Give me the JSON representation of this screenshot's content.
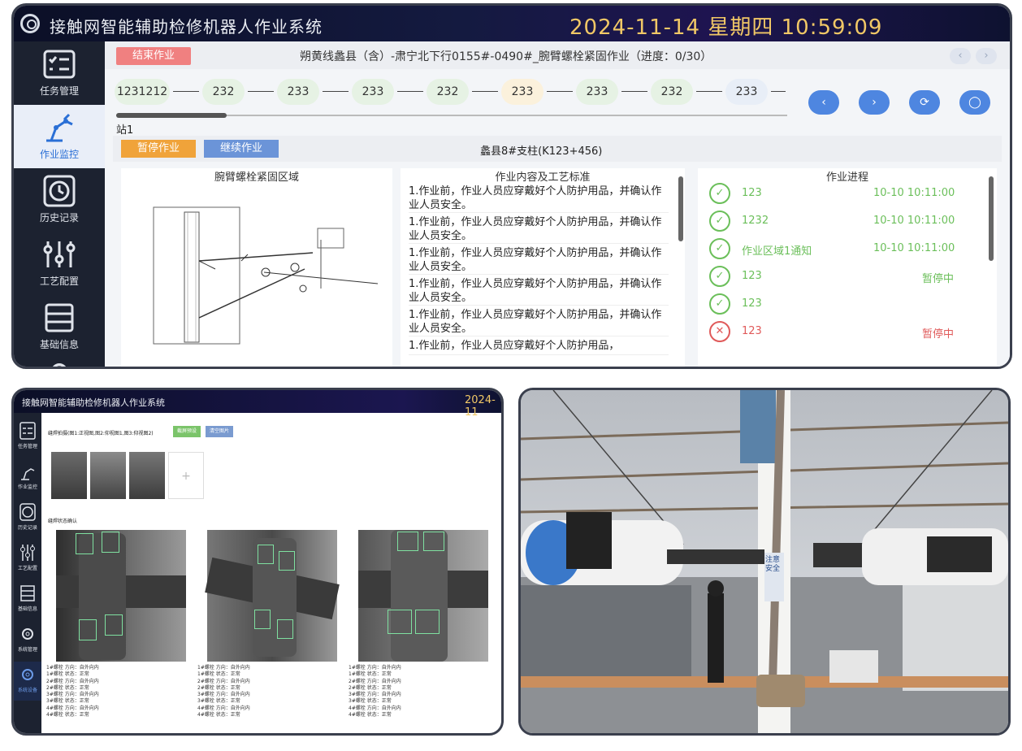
{
  "app": {
    "title": "接触网智能辅助检修机器人作业系统",
    "datetime": "2024-11-14 星期四 10:59:09"
  },
  "sidebar": {
    "items": [
      {
        "label": "任务管理"
      },
      {
        "label": "作业监控"
      },
      {
        "label": "历史记录"
      },
      {
        "label": "工艺配置"
      },
      {
        "label": "基础信息"
      }
    ]
  },
  "header": {
    "end_btn": "结束作业",
    "job_title": "朔黄线蠡县（含）-肃宁北下行0155#-0490#_腕臂螺栓紧固作业（进度：0/30）",
    "prev": "‹",
    "next": "›"
  },
  "stations": {
    "nodes": [
      "1231212",
      "232",
      "233",
      "233",
      "232",
      "233",
      "233",
      "232",
      "233"
    ],
    "current_label": "站1"
  },
  "controls": {
    "prev": "‹",
    "next": "›",
    "refresh": "⟳",
    "chat": "◯"
  },
  "work": {
    "pause_btn": "暂停作业",
    "resume_btn": "继续作业",
    "location": "蠡县8#支柱(K123+456)"
  },
  "area": {
    "title": "腕臂螺栓紧固区域"
  },
  "standards": {
    "title": "作业内容及工艺标准",
    "items": [
      "1.作业前，作业人员应穿戴好个人防护用品，并确认作业人员安全。",
      "1.作业前，作业人员应穿戴好个人防护用品，并确认作业人员安全。",
      "1.作业前，作业人员应穿戴好个人防护用品，并确认作业人员安全。",
      "1.作业前，作业人员应穿戴好个人防护用品，并确认作业人员安全。",
      "1.作业前，作业人员应穿戴好个人防护用品，并确认作业人员安全。",
      "1.作业前，作业人员应穿戴好个人防护用品，"
    ]
  },
  "progress": {
    "title": "作业进程",
    "items": [
      {
        "name": "123",
        "time": "10-10 10:11:00",
        "status": ""
      },
      {
        "name": "1232",
        "time": "10-10 10:11:00",
        "status": ""
      },
      {
        "name": "作业区域1通知",
        "time": "10-10 10:11:00",
        "status": ""
      },
      {
        "name": "123",
        "time": "",
        "status": "暂停中"
      },
      {
        "name": "123",
        "time": "",
        "status": ""
      },
      {
        "name": "123",
        "time": "",
        "status": "暂停中"
      }
    ],
    "ok_icon": "✓",
    "err_icon": "✕"
  },
  "p2": {
    "title": "接触网智能辅助检修机器人作业系统",
    "clock": "2024-11",
    "caption": "缝焊拍摄(图1:正视图,图2:仰视图1,图3:仰视图2)",
    "btn_green": "截屏预设",
    "btn_blue": "清空图片",
    "add": "+",
    "confirm_label": "缝焊状态确认",
    "side": [
      "任务管理",
      "作业监控",
      "历史记录",
      "工艺配置",
      "基础信息",
      "系统管理",
      "系统设备"
    ],
    "results": [
      [
        "1#螺栓 方向：自外向内",
        "1#螺栓 状态：正常",
        "2#螺栓 方向：自外向内",
        "2#螺栓 状态：正常",
        "3#螺栓 方向：自外向内",
        "3#螺栓 状态：正常",
        "4#螺栓 方向：自外向内",
        "4#螺栓 状态：正常"
      ],
      [
        "1#螺栓 方向：自外向内",
        "1#螺栓 状态：正常",
        "2#螺栓 方向：自外向内",
        "2#螺栓 状态：正常",
        "3#螺栓 方向：自外向内",
        "3#螺栓 状态：正常",
        "4#螺栓 方向：自外向内",
        "4#螺栓 状态：正常"
      ],
      [
        "1#螺栓 方向：自外向内",
        "1#螺栓 状态：正常",
        "2#螺栓 方向：自外向内",
        "2#螺栓 状态：正常",
        "3#螺栓 方向：自外向内",
        "3#螺栓 状态：正常",
        "4#螺栓 方向：自外向内",
        "4#螺栓 状态：正常"
      ]
    ]
  },
  "photo": {
    "sign": "注意安全"
  }
}
